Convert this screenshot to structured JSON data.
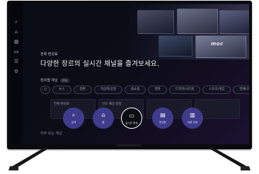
{
  "sidebar": {
    "icons": [
      "search-icon",
      "home-icon",
      "grid-icon",
      "tv-icon",
      "list-icon",
      "settings-icon"
    ]
  },
  "hero": {
    "breadcrumb": "전체 편성표",
    "headline": "다양한 장르의 실시간 채널을 즐겨보세요.",
    "tile_text": "moc"
  },
  "category": {
    "label": "장르별 채널",
    "count": "153",
    "chips": [
      "뉴스",
      "종편",
      "지상파/공영",
      "홈쇼핑",
      "영화",
      "드라마/시트콤",
      "스포츠/게임",
      "연예/오락",
      "애니"
    ]
  },
  "cards": [
    {
      "label": "전체 편성표"
    },
    {
      "label": "선호 채널 설정"
    },
    {
      "label": ""
    },
    {
      "label": ""
    }
  ],
  "bottom_label": "자주 보는 채널",
  "menu": [
    {
      "label": "검색",
      "icon": "search-icon",
      "glyph": "⌕",
      "active": false
    },
    {
      "label": "홈",
      "icon": "home-icon",
      "glyph": "⌂",
      "active": false
    },
    {
      "label": "실시간 방송",
      "icon": "live-tv-icon",
      "glyph": "▭",
      "active": true
    },
    {
      "label": "편성표",
      "icon": "schedule-icon",
      "glyph": "▤",
      "active": false
    },
    {
      "label": "이용 안내",
      "icon": "guide-icon",
      "glyph": "▥",
      "active": false
    }
  ],
  "colors": {
    "menu_accent": "#3f3c8c",
    "screen_bg": "#0b0d17"
  }
}
